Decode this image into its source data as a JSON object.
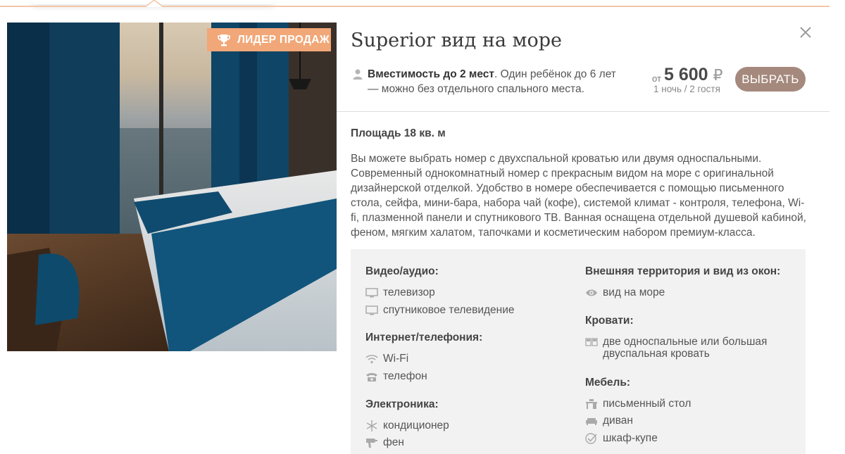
{
  "badge": {
    "label": "ЛИДЕР ПРОДАЖ"
  },
  "room": {
    "title": "Superior вид на море",
    "capacity_bold": "Вместимость до 2 мест",
    "capacity_rest": ". Один ребёнок до 6 лет — можно без отдельного спального места.",
    "price_from": "от",
    "price": "5 600",
    "currency": "₽",
    "price_note": "1 ночь / 2 гостя",
    "select_button": "ВЫБРАТЬ",
    "area": "Площадь 18 кв. м",
    "description": "Вы можете выбрать номер с двухспальной кроватью или двумя односпальными. Современный однокомнатный номер с прекрасным видом на море с оригинальной дизайнерской отделкой. Удобство в номере обеспечивается с помощью письменного стола, сейфа, мини-бара, набора чай (кофе), системой климат - контроля, телефона, Wi-fi, плазменной панели и спутникового ТВ. Ванная оснащена отдельной душевой кабиной, феном, мягким халатом, тапочками и косметическим набором премиум-класса."
  },
  "amenities": {
    "video": {
      "heading": "Видео/аудио:",
      "items": [
        "телевизор",
        "спутниковое телевидение"
      ],
      "icons": [
        "tv-icon",
        "tv-icon"
      ]
    },
    "internet": {
      "heading": "Интернет/телефония:",
      "items": [
        "Wi-Fi",
        "телефон"
      ],
      "icons": [
        "wifi-icon",
        "phone-icon"
      ]
    },
    "electronics": {
      "heading": "Электроника:",
      "items": [
        "кондиционер",
        "фен"
      ],
      "icons": [
        "snowflake-icon",
        "hairdryer-icon"
      ]
    },
    "territory": {
      "heading": "Внешняя территория и вид из окон:",
      "items": [
        "вид на море"
      ],
      "icons": [
        "eye-icon"
      ]
    },
    "beds": {
      "heading": "Кровати:",
      "items": [
        "две односпальные или большая двуспальная кровать"
      ],
      "icons": [
        "beds-icon"
      ]
    },
    "furniture": {
      "heading": "Мебель:",
      "items": [
        "письменный стол",
        "диван",
        "шкаф-купе"
      ],
      "icons": [
        "desk-icon",
        "sofa-icon",
        "checkmark-icon"
      ]
    }
  },
  "colors": {
    "accent": "#f1a777",
    "button": "#a5897d",
    "panel": "#f2f2f2",
    "topline": "#f3c6a7"
  }
}
